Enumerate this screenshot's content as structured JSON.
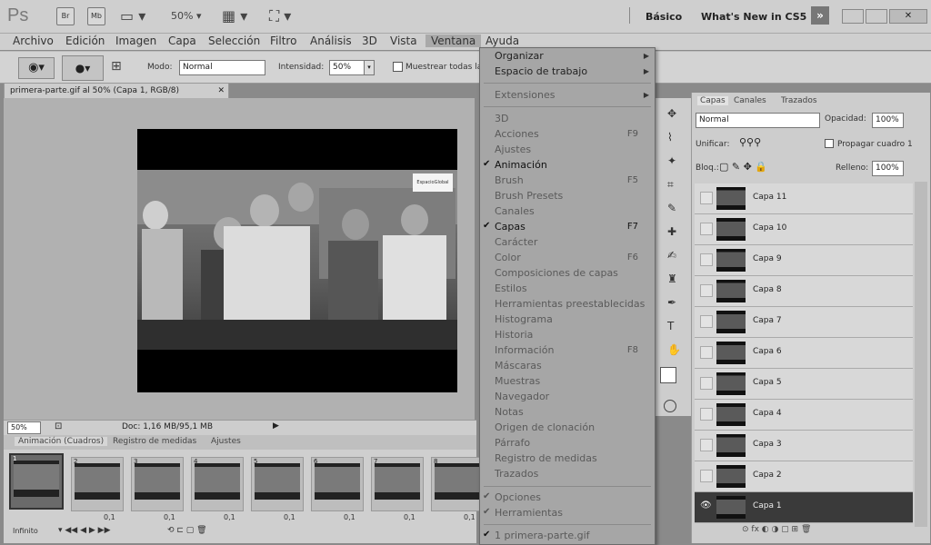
{
  "app": {
    "logo": "Ps",
    "zoom": "50%",
    "workspaces": [
      "Básico",
      "What's New in CS5"
    ],
    "bridge_label": "Br",
    "minibridge_label": "Mb"
  },
  "menubar": [
    "Archivo",
    "Edición",
    "Imagen",
    "Capa",
    "Selección",
    "Filtro",
    "Análisis",
    "3D",
    "Vista",
    "Ventana",
    "Ayuda"
  ],
  "options": {
    "mode_label": "Modo:",
    "mode_value": "Normal",
    "intensity_label": "Intensidad:",
    "intensity_value": "50%",
    "sample_all": "Muestrear todas las capas"
  },
  "document": {
    "tab_title": "primera-parte.gif al 50% (Capa 1, RGB/8)",
    "watermark": "EspacioGlobal",
    "status_zoom": "50%",
    "status_doc": "Doc: 1,16 MB/95,1 MB"
  },
  "animation": {
    "tabs": [
      "Animación (Cuadros)",
      "Registro de medidas",
      "Ajustes"
    ],
    "frame_time": "0,1",
    "loop": "Infinito",
    "frames": [
      "1",
      "2",
      "3",
      "4",
      "5",
      "6",
      "7",
      "8"
    ]
  },
  "dropdown": {
    "items": [
      {
        "label": "Organizar",
        "sub": true,
        "enabled": true
      },
      {
        "label": "Espacio de trabajo",
        "sub": true,
        "enabled": true
      },
      {
        "label": "Extensiones",
        "sub": true,
        "enabled": false
      },
      {
        "label": "3D",
        "enabled": false
      },
      {
        "label": "Acciones",
        "shortcut": "F9",
        "enabled": false
      },
      {
        "label": "Ajustes",
        "enabled": false
      },
      {
        "label": "Animación",
        "checked": true,
        "enabled": true
      },
      {
        "label": "Brush",
        "shortcut": "F5",
        "enabled": false
      },
      {
        "label": "Brush Presets",
        "enabled": false
      },
      {
        "label": "Canales",
        "enabled": false
      },
      {
        "label": "Capas",
        "checked": true,
        "shortcut": "F7",
        "enabled": true
      },
      {
        "label": "Carácter",
        "enabled": false
      },
      {
        "label": "Color",
        "shortcut": "F6",
        "enabled": false
      },
      {
        "label": "Composiciones de capas",
        "enabled": false
      },
      {
        "label": "Estilos",
        "enabled": false
      },
      {
        "label": "Herramientas preestablecidas",
        "enabled": false
      },
      {
        "label": "Histograma",
        "enabled": false
      },
      {
        "label": "Historia",
        "enabled": false
      },
      {
        "label": "Información",
        "shortcut": "F8",
        "enabled": false
      },
      {
        "label": "Máscaras",
        "enabled": false
      },
      {
        "label": "Muestras",
        "enabled": false
      },
      {
        "label": "Navegador",
        "enabled": false
      },
      {
        "label": "Notas",
        "enabled": false
      },
      {
        "label": "Origen de clonación",
        "enabled": false
      },
      {
        "label": "Párrafo",
        "enabled": false
      },
      {
        "label": "Registro de medidas",
        "enabled": false
      },
      {
        "label": "Trazados",
        "enabled": false
      },
      {
        "label": "Opciones",
        "checked": true,
        "enabled": false
      },
      {
        "label": "Herramientas",
        "checked": true,
        "enabled": false
      },
      {
        "label": "1 primera-parte.gif",
        "checked": true,
        "enabled": false
      }
    ]
  },
  "layers": {
    "tabs": [
      "Capas",
      "Canales",
      "Trazados"
    ],
    "blend": "Normal",
    "opacity_label": "Opacidad:",
    "opacity_value": "100%",
    "unify_label": "Unificar:",
    "propagate": "Propagar cuadro 1",
    "lock_label": "Bloq.:",
    "fill_label": "Relleno:",
    "fill_value": "100%",
    "rows": [
      "Capa 11",
      "Capa 10",
      "Capa 9",
      "Capa 8",
      "Capa 7",
      "Capa 6",
      "Capa 5",
      "Capa 4",
      "Capa 3",
      "Capa 2",
      "Capa 1"
    ],
    "selected": "Capa 1"
  }
}
